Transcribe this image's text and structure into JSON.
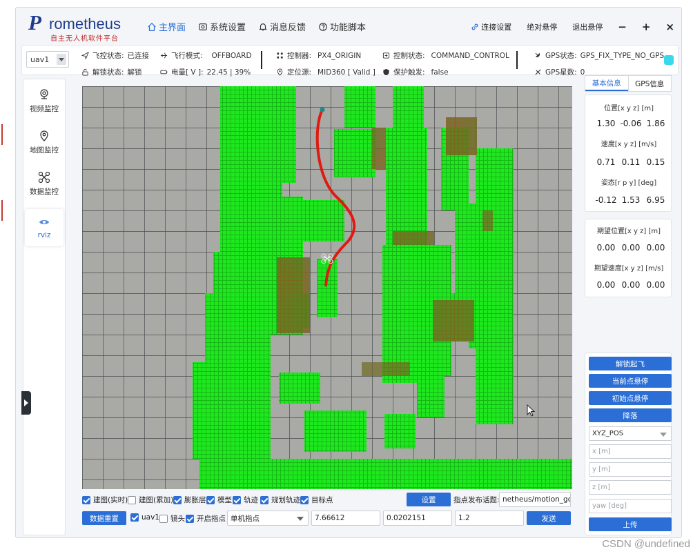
{
  "app": {
    "logo_letter": "P",
    "logo_text": "rometheus",
    "logo_subtitle": "自主无人机软件平台"
  },
  "nav": {
    "items": [
      {
        "label": "主界面",
        "icon": "home-icon",
        "active": true
      },
      {
        "label": "系统设置",
        "icon": "settings-icon",
        "active": false
      },
      {
        "label": "消息反馈",
        "icon": "bell-icon",
        "active": false
      },
      {
        "label": "功能脚本",
        "icon": "help-icon",
        "active": false
      }
    ],
    "link_settings": "连接设置",
    "abs_hover": "绝对悬停",
    "exit_hover": "退出悬停",
    "min_glyph": "−",
    "max_glyph": "+",
    "close_glyph": "×"
  },
  "status": {
    "uav_selected": "uav1",
    "fc_state_label": "飞控状态:",
    "fc_state_value": "已连接",
    "flight_mode_label": "飞行模式:",
    "flight_mode_value": "OFFBOARD",
    "unlock_label": "解锁状态:",
    "unlock_value": "解锁",
    "battery_label": "电量[ V ]:",
    "battery_value": "22.45 | 39%",
    "controller_label": "控制器:",
    "controller_value": "PX4_ORIGIN",
    "locator_label": "定位源:",
    "locator_value": "MID360 [ Valid ]",
    "control_state_label": "控制状态:",
    "control_state_value": "COMMAND_CONTROL",
    "protect_label": "保护触发:",
    "protect_value": "false",
    "gps_state_label": "GPS状态:",
    "gps_state_value": "GPS_FIX_TYPE_NO_GPS",
    "gps_sats_label": "GPS星数:",
    "gps_sats_value": "0",
    "indicator_color": "#3ad8ef"
  },
  "sidebar": {
    "items": [
      {
        "label": "视频监控",
        "icon": "camera-icon",
        "active": false
      },
      {
        "label": "地图监控",
        "icon": "map-pin-icon",
        "active": false
      },
      {
        "label": "数据监控",
        "icon": "drone-icon",
        "active": false
      },
      {
        "label": "rviz",
        "icon": "rviz-icon",
        "active": true
      }
    ]
  },
  "bottom": {
    "checks": [
      {
        "label": "建图(实时)",
        "checked": true
      },
      {
        "label": "建图(累加)",
        "checked": false
      },
      {
        "label": "膨胀层",
        "checked": true
      },
      {
        "label": "模型",
        "checked": true
      },
      {
        "label": "轨迹",
        "checked": true
      },
      {
        "label": "规划轨迹",
        "checked": true
      },
      {
        "label": "目标点",
        "checked": true
      }
    ],
    "settings_button": "设置",
    "topic_label": "指点发布话题:",
    "topic_value": "netheus/motion_goal",
    "reset_button": "数据重置",
    "uav1_label": "uav1",
    "uav1_checked": true,
    "lens_label": "镜头",
    "lens_checked": false,
    "enable_point_label": "开启指点",
    "enable_point_checked": true,
    "mode_selected": "单机指点",
    "x_value": "7.66612",
    "y_value": "0.0202151",
    "z_value": "1.2",
    "send_button": "发送"
  },
  "right": {
    "tab_basic": "基本信息",
    "tab_gps": "GPS信息",
    "pos_label": "位置[x y z] [m]",
    "pos": [
      "1.30",
      "-0.06",
      "1.86"
    ],
    "vel_label": "速度[x y z] [m/s]",
    "vel": [
      "0.71",
      "0.11",
      "0.15"
    ],
    "att_label": "姿态[r p y] [deg]",
    "att": [
      "-0.12",
      "1.53",
      "6.95"
    ],
    "exp_pos_label": "期望位置[x y z] [m]",
    "exp_pos": [
      "0.00",
      "0.00",
      "0.00"
    ],
    "exp_vel_label": "期望速度[x y z] [m/s]",
    "exp_vel": [
      "0.00",
      "0.00",
      "0.00"
    ],
    "btn_unlock_takeoff": "解锁起飞",
    "btn_hover_current": "当前点悬停",
    "btn_hover_init": "初始点悬停",
    "btn_land": "降落",
    "frame_selected": "XYZ_POS",
    "ph_x": "x [m]",
    "ph_y": "y [m]",
    "ph_z": "z [m]",
    "ph_yaw": "yaw [deg]",
    "btn_upload": "上传"
  },
  "watermark": "CSDN @undefined"
}
